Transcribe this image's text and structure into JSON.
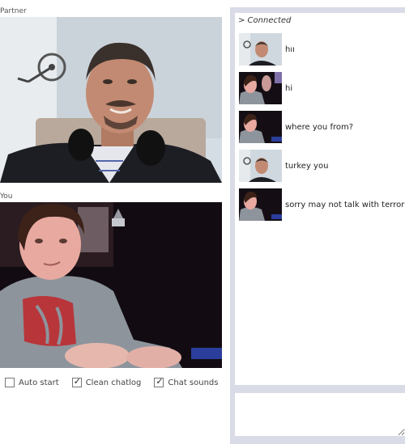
{
  "labels": {
    "partner": "Partner",
    "you": "You"
  },
  "options": [
    {
      "label": "Auto start",
      "checked": false
    },
    {
      "label": "Clean chatlog",
      "checked": true
    },
    {
      "label": "Chat sounds",
      "checked": true
    }
  ],
  "chat": {
    "status": "> Connected",
    "messages": [
      {
        "author": "partner",
        "text": "hıı"
      },
      {
        "author": "you",
        "text": "hi"
      },
      {
        "author": "you",
        "text": "where you from?"
      },
      {
        "author": "partner",
        "text": "turkey you"
      },
      {
        "author": "you",
        "text": "sorry may not talk with terrori"
      }
    ],
    "input_value": ""
  },
  "colors": {
    "frame": "#d9dbe6",
    "partner_wall": "#cfd8e0",
    "you_background": "#120c12",
    "sweater": "#8d949c",
    "sweater_print": "#b8353a"
  }
}
